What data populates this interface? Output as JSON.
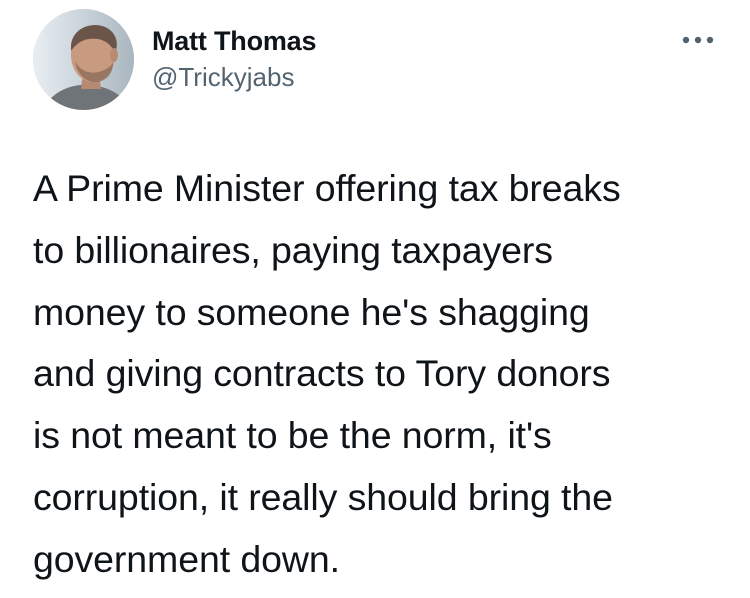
{
  "author": {
    "display_name": "Matt Thomas",
    "handle": "@Trickyjabs",
    "avatar_icon": "profile-photo"
  },
  "menu": {
    "icon": "more-horizontal-icon"
  },
  "tweet": {
    "lines": [
      "A Prime Minister offering tax breaks",
      "to billionaires, paying taxpayers",
      "money to someone he's shagging",
      "and giving contracts to Tory donors",
      "is not meant to be the norm, it's",
      "corruption, it really should bring the",
      "government down."
    ]
  },
  "colors": {
    "text": "#0f1419",
    "handle": "#536471",
    "icon": "#536471"
  }
}
